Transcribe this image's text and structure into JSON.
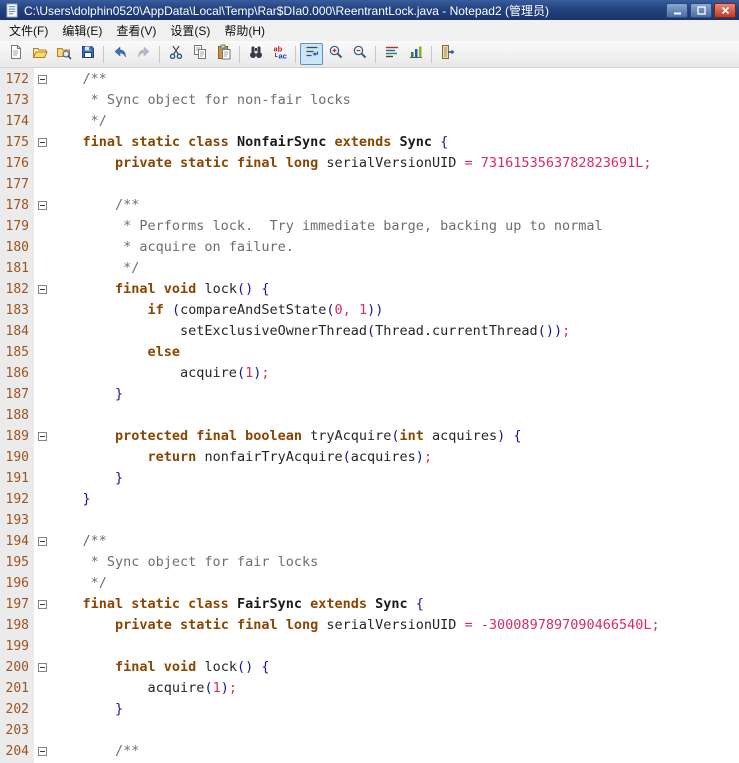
{
  "window": {
    "title": "C:\\Users\\dolphin0520\\AppData\\Local\\Temp\\Rar$DIa0.000\\ReentrantLock.java - Notepad2 (管理员)",
    "controls": [
      "minimize",
      "maximize",
      "close"
    ]
  },
  "menu": {
    "items": [
      {
        "name": "file",
        "label": "文件(F)"
      },
      {
        "name": "edit",
        "label": "编辑(E)"
      },
      {
        "name": "view",
        "label": "查看(V)"
      },
      {
        "name": "settings",
        "label": "设置(S)"
      },
      {
        "name": "help",
        "label": "帮助(H)"
      }
    ]
  },
  "toolbar": {
    "items": [
      {
        "type": "button",
        "name": "new-file"
      },
      {
        "type": "button",
        "name": "open-file"
      },
      {
        "type": "button",
        "name": "browse-files"
      },
      {
        "type": "button",
        "name": "save-file"
      },
      {
        "type": "separator"
      },
      {
        "type": "button",
        "name": "undo"
      },
      {
        "type": "button",
        "name": "redo",
        "disabled": true
      },
      {
        "type": "separator"
      },
      {
        "type": "button",
        "name": "cut"
      },
      {
        "type": "button",
        "name": "copy"
      },
      {
        "type": "button",
        "name": "paste"
      },
      {
        "type": "separator"
      },
      {
        "type": "button",
        "name": "find"
      },
      {
        "type": "button",
        "name": "replace"
      },
      {
        "type": "separator"
      },
      {
        "type": "button",
        "name": "word-wrap",
        "active": true
      },
      {
        "type": "button",
        "name": "zoom-in"
      },
      {
        "type": "button",
        "name": "zoom-out"
      },
      {
        "type": "separator"
      },
      {
        "type": "button",
        "name": "view-schemes"
      },
      {
        "type": "button",
        "name": "customize-schemes"
      },
      {
        "type": "separator"
      },
      {
        "type": "button",
        "name": "exit"
      }
    ]
  },
  "editor": {
    "lines": [
      {
        "n": 172,
        "f": 1,
        "t": [
          [
            "c",
            "    /**"
          ]
        ]
      },
      {
        "n": 173,
        "t": [
          [
            "c",
            "     * Sync object for non-fair locks"
          ]
        ]
      },
      {
        "n": 174,
        "t": [
          [
            "c",
            "     */"
          ]
        ]
      },
      {
        "n": 175,
        "f": 1,
        "t": [
          [
            "pl",
            "    "
          ],
          [
            "k",
            "final static class "
          ],
          [
            "cn",
            "NonfairSync "
          ],
          [
            "k",
            "extends "
          ],
          [
            "cn",
            "Sync "
          ],
          [
            "b",
            "{"
          ]
        ]
      },
      {
        "n": 176,
        "t": [
          [
            "pl",
            "        "
          ],
          [
            "k",
            "private static final long "
          ],
          [
            "pl",
            "serialVersionUID "
          ],
          [
            "o",
            "= "
          ],
          [
            "n",
            "7316153563782823691L"
          ],
          [
            "o",
            ";"
          ]
        ]
      },
      {
        "n": 177,
        "t": []
      },
      {
        "n": 178,
        "f": 1,
        "t": [
          [
            "c",
            "        /**"
          ]
        ]
      },
      {
        "n": 179,
        "t": [
          [
            "c",
            "         * Performs lock.  Try immediate barge, backing up to normal"
          ]
        ]
      },
      {
        "n": 180,
        "t": [
          [
            "c",
            "         * acquire on failure."
          ]
        ]
      },
      {
        "n": 181,
        "t": [
          [
            "c",
            "         */"
          ]
        ]
      },
      {
        "n": 182,
        "f": 1,
        "t": [
          [
            "pl",
            "        "
          ],
          [
            "k",
            "final void "
          ],
          [
            "pl",
            "lock"
          ],
          [
            "b",
            "() {"
          ]
        ]
      },
      {
        "n": 183,
        "t": [
          [
            "pl",
            "            "
          ],
          [
            "k",
            "if "
          ],
          [
            "b",
            "("
          ],
          [
            "pl",
            "compareAndSetState"
          ],
          [
            "b",
            "("
          ],
          [
            "n",
            "0"
          ],
          [
            "o",
            ", "
          ],
          [
            "n",
            "1"
          ],
          [
            "b",
            "))"
          ]
        ]
      },
      {
        "n": 184,
        "t": [
          [
            "pl",
            "                setExclusiveOwnerThread"
          ],
          [
            "b",
            "("
          ],
          [
            "pl",
            "Thread.currentThread"
          ],
          [
            "b",
            "())"
          ],
          [
            "o",
            ";"
          ]
        ]
      },
      {
        "n": 185,
        "t": [
          [
            "pl",
            "            "
          ],
          [
            "k",
            "else"
          ]
        ]
      },
      {
        "n": 186,
        "t": [
          [
            "pl",
            "                acquire"
          ],
          [
            "b",
            "("
          ],
          [
            "n",
            "1"
          ],
          [
            "b",
            ")"
          ],
          [
            "o",
            ";"
          ]
        ]
      },
      {
        "n": 187,
        "t": [
          [
            "pl",
            "        "
          ],
          [
            "b",
            "}"
          ]
        ]
      },
      {
        "n": 188,
        "t": []
      },
      {
        "n": 189,
        "f": 1,
        "t": [
          [
            "pl",
            "        "
          ],
          [
            "k",
            "protected final boolean "
          ],
          [
            "pl",
            "tryAcquire"
          ],
          [
            "b",
            "("
          ],
          [
            "k",
            "int "
          ],
          [
            "pl",
            "acquires"
          ],
          [
            "b",
            ") {"
          ]
        ]
      },
      {
        "n": 190,
        "t": [
          [
            "pl",
            "            "
          ],
          [
            "k",
            "return "
          ],
          [
            "pl",
            "nonfairTryAcquire"
          ],
          [
            "b",
            "("
          ],
          [
            "pl",
            "acquires"
          ],
          [
            "b",
            ")"
          ],
          [
            "o",
            ";"
          ]
        ]
      },
      {
        "n": 191,
        "t": [
          [
            "pl",
            "        "
          ],
          [
            "b",
            "}"
          ]
        ]
      },
      {
        "n": 192,
        "t": [
          [
            "pl",
            "    "
          ],
          [
            "b",
            "}"
          ]
        ]
      },
      {
        "n": 193,
        "t": []
      },
      {
        "n": 194,
        "f": 1,
        "t": [
          [
            "c",
            "    /**"
          ]
        ]
      },
      {
        "n": 195,
        "t": [
          [
            "c",
            "     * Sync object for fair locks"
          ]
        ]
      },
      {
        "n": 196,
        "t": [
          [
            "c",
            "     */"
          ]
        ]
      },
      {
        "n": 197,
        "f": 1,
        "t": [
          [
            "pl",
            "    "
          ],
          [
            "k",
            "final static class "
          ],
          [
            "cn",
            "FairSync "
          ],
          [
            "k",
            "extends "
          ],
          [
            "cn",
            "Sync "
          ],
          [
            "b",
            "{"
          ]
        ]
      },
      {
        "n": 198,
        "t": [
          [
            "pl",
            "        "
          ],
          [
            "k",
            "private static final long "
          ],
          [
            "pl",
            "serialVersionUID "
          ],
          [
            "o",
            "= "
          ],
          [
            "n",
            "-3000897897090466540L"
          ],
          [
            "o",
            ";"
          ]
        ]
      },
      {
        "n": 199,
        "t": []
      },
      {
        "n": 200,
        "f": 1,
        "t": [
          [
            "pl",
            "        "
          ],
          [
            "k",
            "final void "
          ],
          [
            "pl",
            "lock"
          ],
          [
            "b",
            "() {"
          ]
        ]
      },
      {
        "n": 201,
        "t": [
          [
            "pl",
            "            acquire"
          ],
          [
            "b",
            "("
          ],
          [
            "n",
            "1"
          ],
          [
            "b",
            ")"
          ],
          [
            "o",
            ";"
          ]
        ]
      },
      {
        "n": 202,
        "t": [
          [
            "pl",
            "        "
          ],
          [
            "b",
            "}"
          ]
        ]
      },
      {
        "n": 203,
        "t": []
      },
      {
        "n": 204,
        "f": 1,
        "t": [
          [
            "c",
            "        /**"
          ]
        ]
      }
    ]
  },
  "colors": {
    "titlebar": "#1a346e",
    "keyword": "#8a4500",
    "comment": "#6e6e6e",
    "number": "#d92b63",
    "operator": "#d92b63",
    "brace": "#16169a",
    "classname": "#1a1a1a",
    "plain": "#262626",
    "line_number": "#9e5420",
    "toolbar_active_bg": "#cde6f7",
    "toolbar_active_border": "#5c93c4"
  }
}
